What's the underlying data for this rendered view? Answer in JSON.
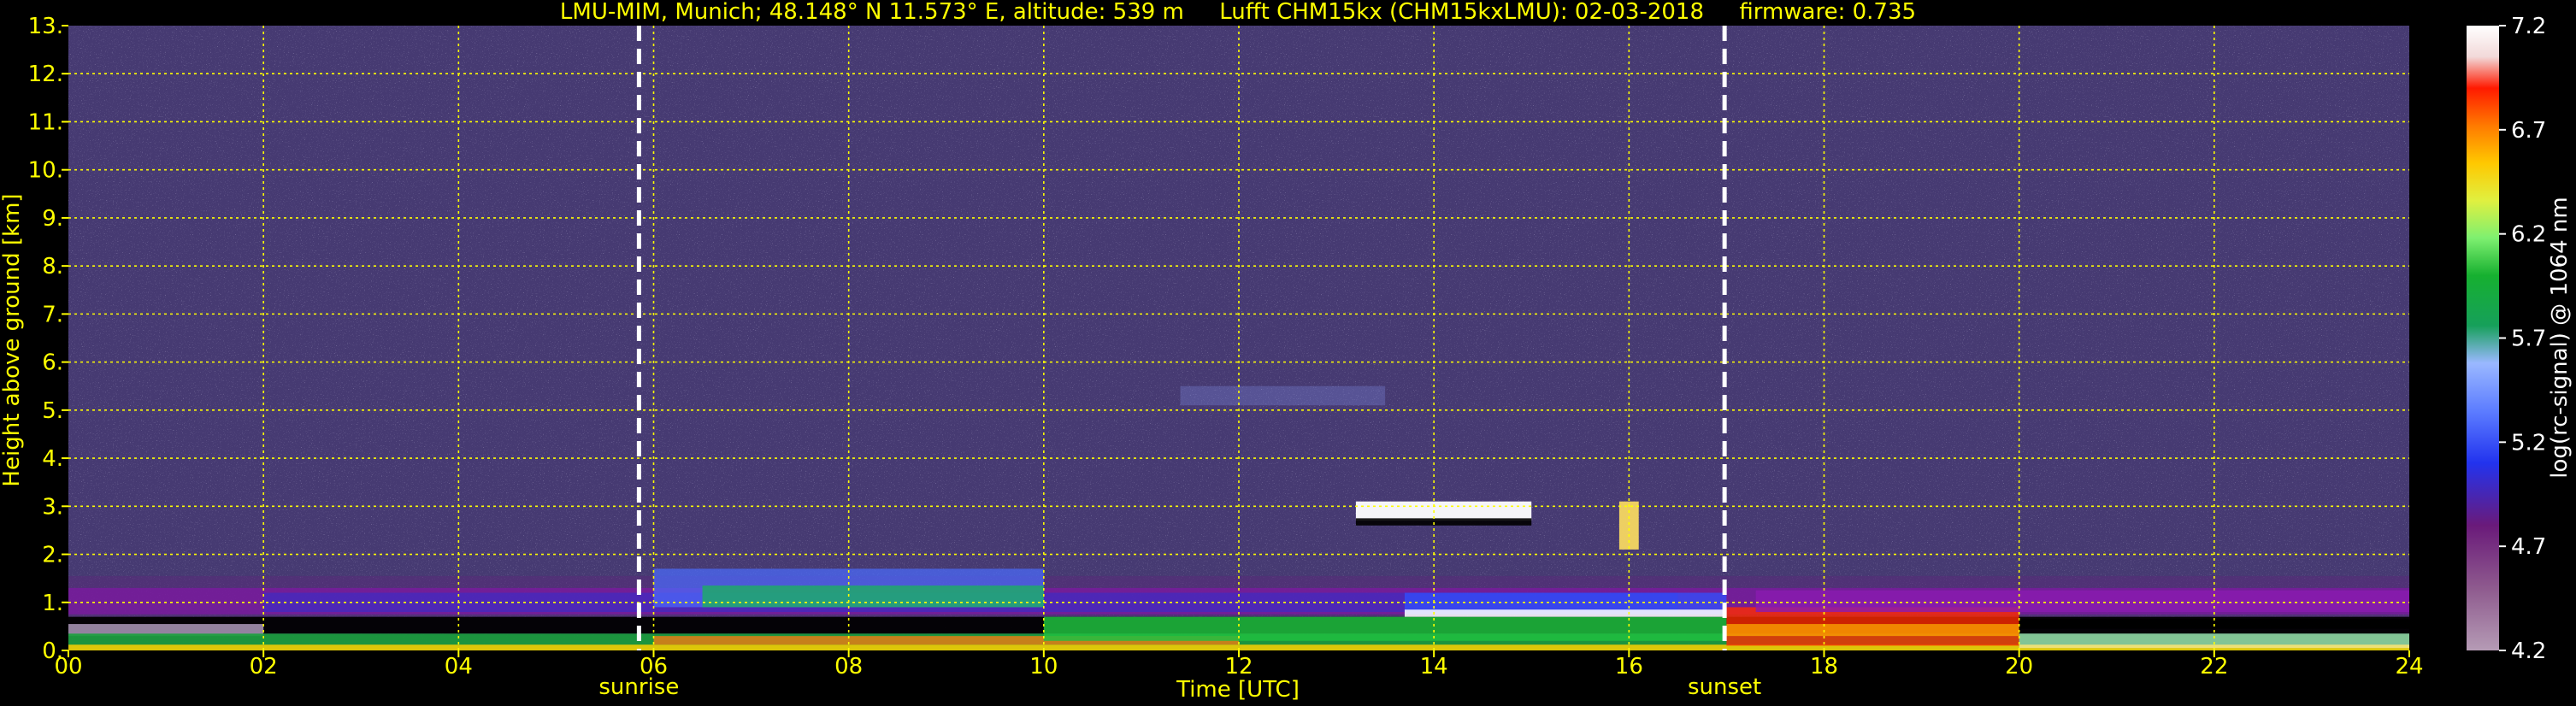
{
  "chart_data": {
    "type": "heatmap",
    "title": "LMU-MIM, Munich; 48.148° N 11.573° E, altitude: 539 m     Lufft CHM15kx (CHM15kxLMU): 02-03-2018     firmware: 0.735",
    "xlabel": "Time [UTC]",
    "ylabel": "Height above ground [km]",
    "x_ticks": [
      "00",
      "02",
      "04",
      "06",
      "08",
      "10",
      "12",
      "14",
      "16",
      "18",
      "20",
      "22",
      "24"
    ],
    "y_ticks": [
      "0.",
      "1.",
      "2.",
      "3.",
      "4.",
      "5.",
      "6.",
      "7.",
      "8.",
      "9.",
      "10.",
      "11.",
      "12.",
      "13."
    ],
    "xlim": [
      0,
      24
    ],
    "ylim": [
      0,
      13
    ],
    "grid": true,
    "annotations": [
      {
        "label": "sunrise",
        "time": 5.85
      },
      {
        "label": "sunset",
        "time": 16.98
      }
    ],
    "colorbar": {
      "label": "log(rc-signal) @ 1064 nm",
      "range": [
        4.2,
        7.2
      ],
      "ticks": [
        "4.2",
        "4.7",
        "5.2",
        "5.7",
        "6.2",
        "6.7",
        "7.2"
      ]
    }
  },
  "colors": {
    "text": "#ffff00",
    "grid": "#ffff00",
    "background": "#000000",
    "noise_base": "#463a72"
  }
}
